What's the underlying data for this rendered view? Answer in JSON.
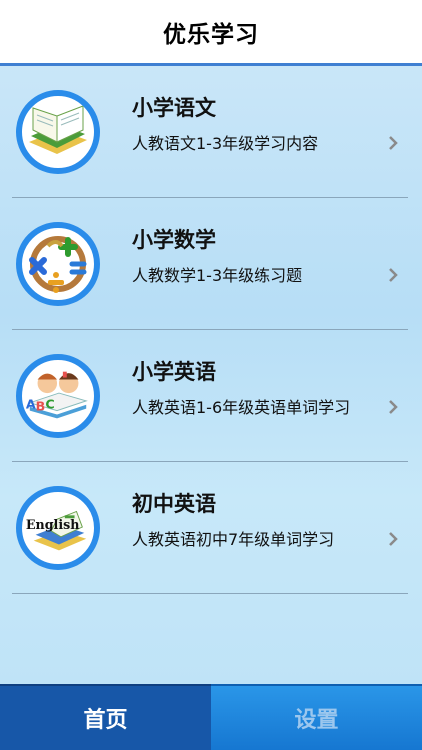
{
  "header": {
    "title": "优乐学习"
  },
  "courses": [
    {
      "title": "小学语文",
      "subtitle": "人教语文1-3年级学习内容",
      "icon": "book-icon"
    },
    {
      "title": "小学数学",
      "subtitle": "人教数学1-3年级练习题",
      "icon": "math-symbols-icon"
    },
    {
      "title": "小学英语",
      "subtitle": "人教英语1-6年级英语单词学习",
      "icon": "kids-abc-book-icon"
    },
    {
      "title": "初中英语",
      "subtitle": "人教英语初中7年级单词学习",
      "icon": "english-book-icon",
      "icon_text": "English"
    }
  ],
  "tabs": [
    {
      "label": "首页",
      "active": true
    },
    {
      "label": "设置",
      "active": false
    }
  ],
  "colors": {
    "accent": "#2a8cea",
    "tab_active": "#1757a8"
  }
}
